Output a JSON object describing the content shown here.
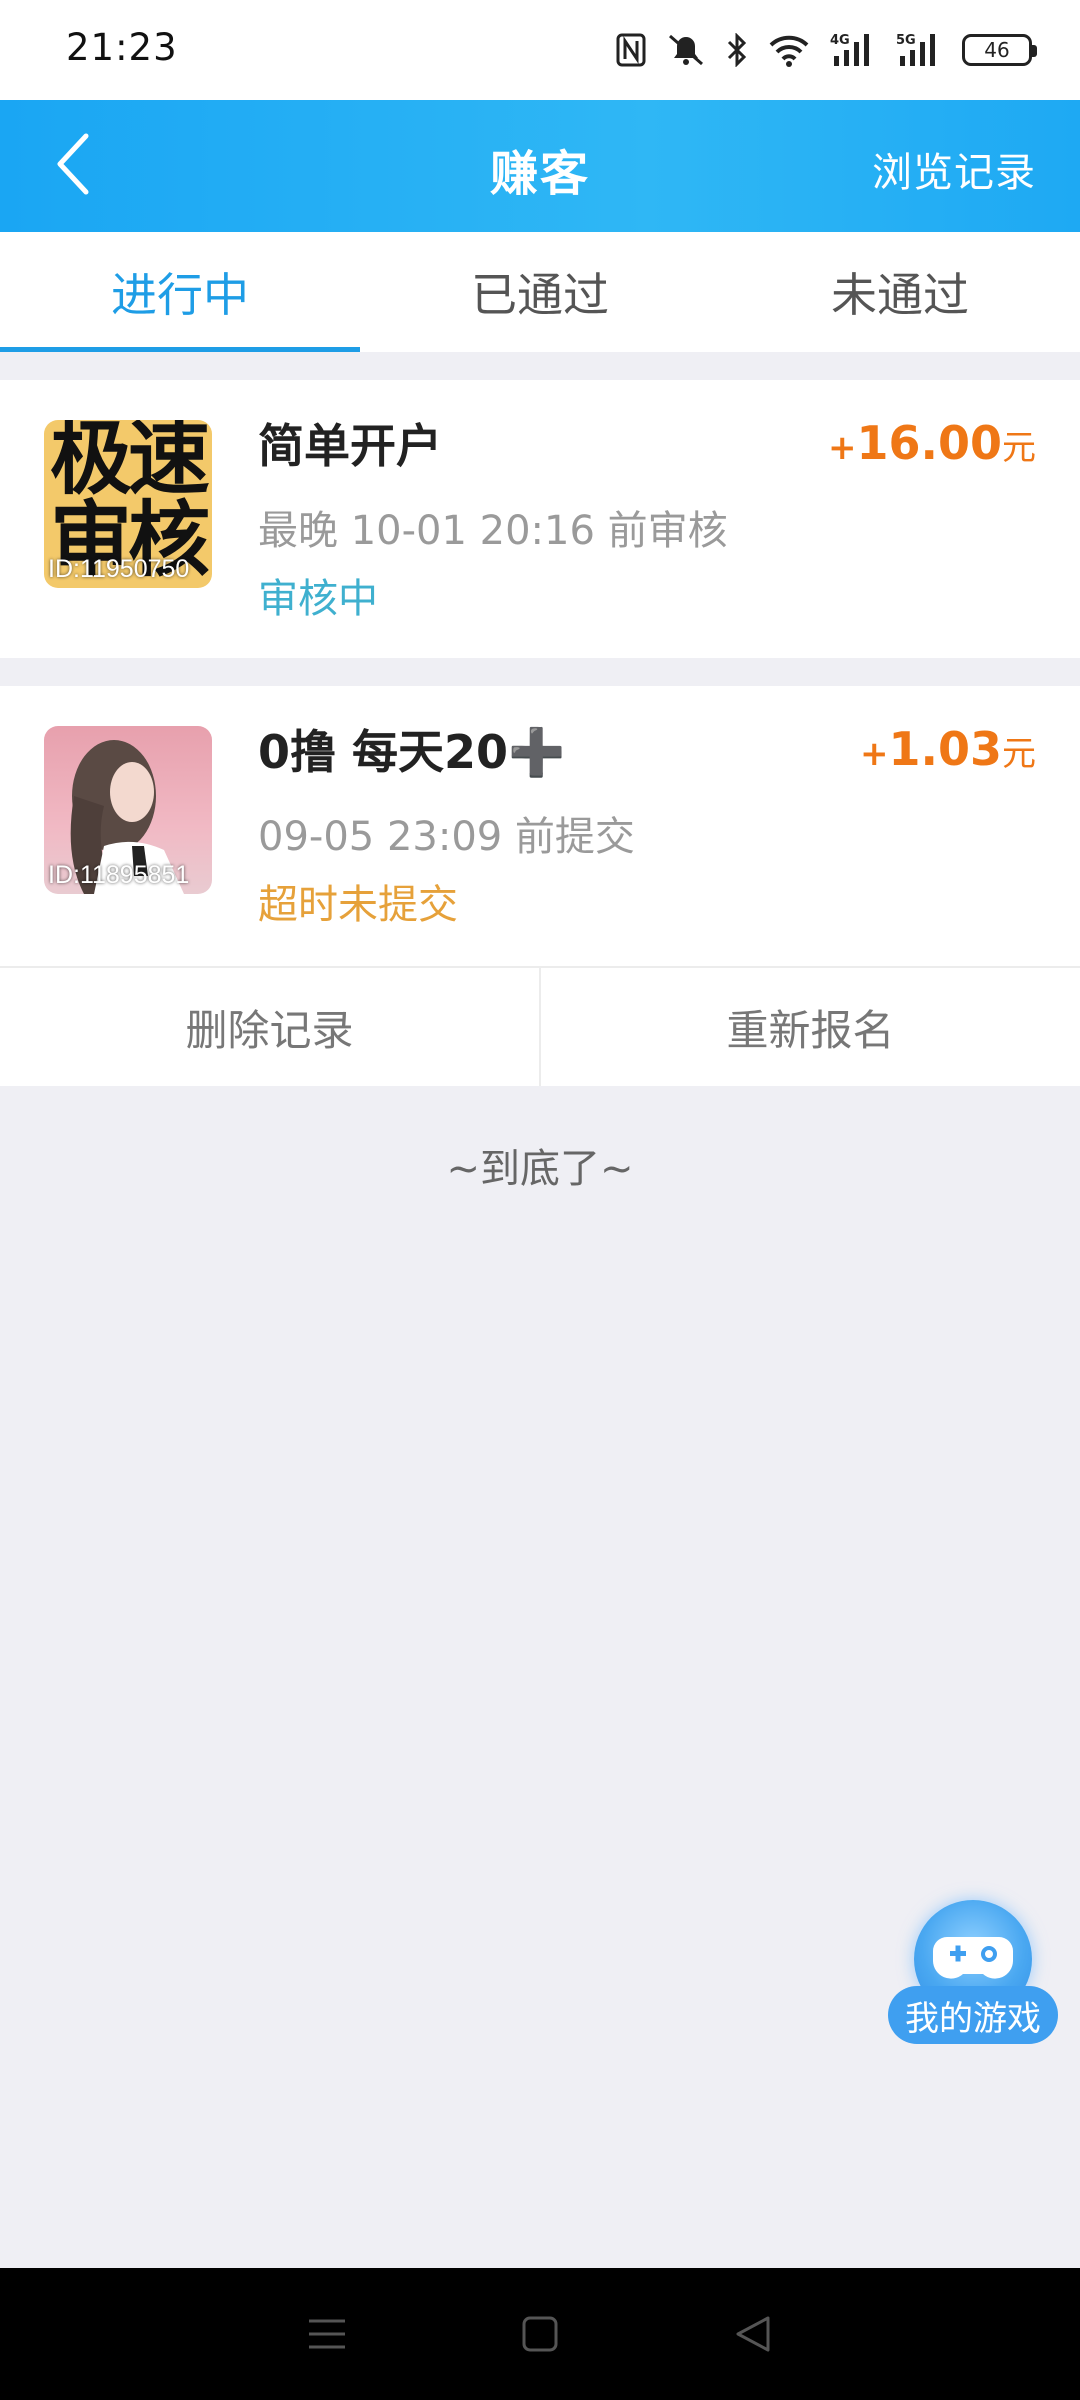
{
  "status_bar": {
    "time": "21:23",
    "battery": "46",
    "icons": [
      "nfc-icon",
      "mute-icon",
      "bluetooth-icon",
      "wifi-icon",
      "signal-4g-icon",
      "signal-5g-icon",
      "battery-icon"
    ]
  },
  "header": {
    "back_icon": "chevron-left-icon",
    "title": "赚客",
    "right_link": "浏览记录"
  },
  "tabs": [
    {
      "label": "进行中",
      "active": true
    },
    {
      "label": "已通过",
      "active": false
    },
    {
      "label": "未通过",
      "active": false
    }
  ],
  "tasks": [
    {
      "thumb_text": "极速审核",
      "id_label": "ID:11950750",
      "title": "简单开户",
      "subtitle": "最晚 10-01 20:16 前审核",
      "status": "审核中",
      "reward_sign": "+",
      "reward_amount": "16.00",
      "reward_unit": "元"
    },
    {
      "id_label": "ID:11895851",
      "title": "0撸 每天20➕",
      "subtitle": "09-05 23:09 前提交",
      "status": "超时未提交",
      "reward_sign": "+",
      "reward_amount": "1.03",
      "reward_unit": "元"
    }
  ],
  "actions": {
    "delete": "删除记录",
    "re_signup": "重新报名"
  },
  "end_text": "~到底了~",
  "fab": {
    "icon": "gamepad-icon",
    "label": "我的游戏"
  },
  "colors": {
    "header_blue": "#1aa6f3",
    "active_tab": "#1e9de6",
    "reward_orange": "#ef7716",
    "status_review": "#3fb0cf",
    "status_timeout": "#e6a13a"
  }
}
